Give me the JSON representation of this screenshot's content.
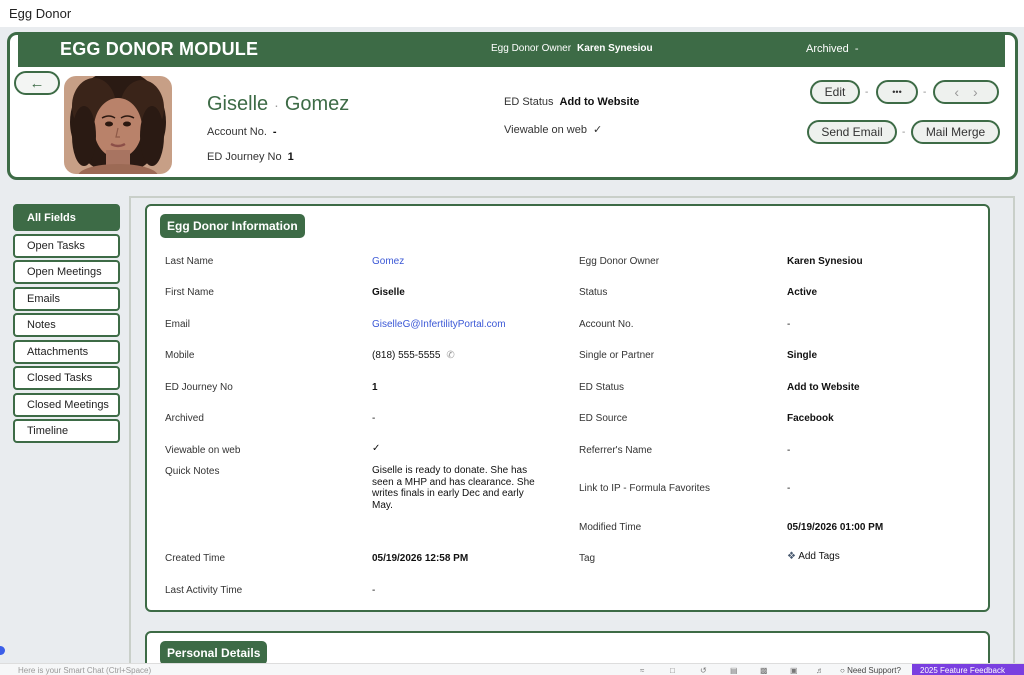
{
  "app": {
    "title": "Egg Donor"
  },
  "module": {
    "title": "EGG DONOR MODULE",
    "owner_label": "Egg Donor Owner",
    "owner_value": "Karen Synesiou",
    "archived_label": "Archived",
    "archived_value": "-"
  },
  "record": {
    "first_name": "Giselle",
    "last_name": "Gomez",
    "name_sep": "·",
    "account_label": "Account No.",
    "account_value": "-",
    "journey_label": "ED Journey No",
    "journey_value": "1",
    "status_label": "ED Status",
    "status_value": "Add to Website",
    "viewable_label": "Viewable on web",
    "viewable_value": "✓"
  },
  "actions": {
    "edit": "Edit",
    "more": "•••",
    "prev": "‹",
    "next": "›",
    "send_email": "Send Email",
    "mail_merge": "Mail Merge",
    "sep": "-"
  },
  "sidebar": {
    "items": [
      {
        "label": "All Fields"
      },
      {
        "label": "Open Tasks"
      },
      {
        "label": "Open Meetings"
      },
      {
        "label": "Emails"
      },
      {
        "label": "Notes"
      },
      {
        "label": "Attachments"
      },
      {
        "label": "Closed Tasks"
      },
      {
        "label": "Closed Meetings"
      },
      {
        "label": "Timeline"
      }
    ]
  },
  "info": {
    "title": "Egg Donor Information",
    "last_name_label": "Last Name",
    "last_name_value": "Gomez",
    "first_name_label": "First Name",
    "first_name_value": "Giselle",
    "email_label": "Email",
    "email_value": "GiselleG@InfertilityPortal.com",
    "mobile_label": "Mobile",
    "mobile_value": "(818) 555-5555",
    "journey_label": "ED Journey No",
    "journey_value": "1",
    "archived_label": "Archived",
    "archived_value": "-",
    "viewable_label": "Viewable on web",
    "viewable_value": "✓",
    "notes_label": "Quick Notes",
    "notes_value": "Giselle is ready to donate.  She has seen a MHP and has clearance.  She writes finals in early Dec and early May.",
    "created_label": "Created Time",
    "created_value": "05/19/2026 12:58 PM",
    "activity_label": "Last Activity Time",
    "activity_value": "-",
    "owner_label": "Egg Donor Owner",
    "owner_value": "Karen Synesiou",
    "status_label": "Status",
    "status_value": "Active",
    "account_label": "Account No.",
    "account_value": "-",
    "single_label": "Single or Partner",
    "single_value": "Single",
    "ed_status_label": "ED Status",
    "ed_status_value": "Add to Website",
    "source_label": "ED Source",
    "source_value": "Facebook",
    "referrer_label": "Referrer's Name",
    "referrer_value": "-",
    "link_label": "Link to IP - Formula Favorites",
    "link_value": "-",
    "modified_label": "Modified Time",
    "modified_value": "05/19/2026 01:00 PM",
    "tag_label": "Tag",
    "tag_value": "Add Tags"
  },
  "personal": {
    "title": "Personal Details"
  },
  "bottom": {
    "chat_placeholder": "Here is your Smart Chat (Ctrl+Space)",
    "support": "Need Support?",
    "feedback": "2025 Feature Feedback"
  },
  "colors": {
    "brand": "#3d6b46",
    "link": "#3b58d6",
    "feedback": "#7a3fe0"
  }
}
